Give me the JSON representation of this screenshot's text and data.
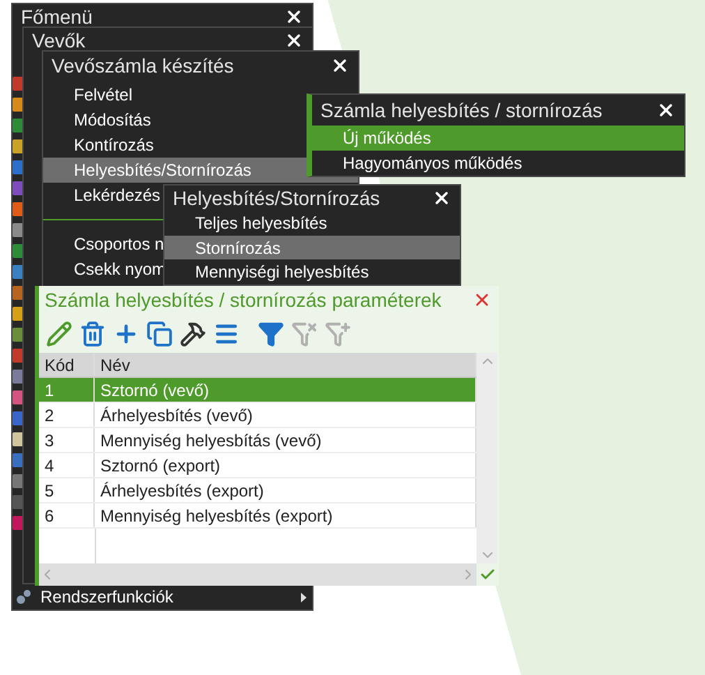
{
  "main_menu": {
    "title": "Főmenü",
    "footer_item": "Rendszerfunkciók"
  },
  "menus": [
    {
      "title": "Vevők"
    },
    {
      "title": "Vevőszámla készítés",
      "items": [
        {
          "label": "Felvétel",
          "selected": false
        },
        {
          "label": "Módosítás",
          "selected": false
        },
        {
          "label": "Kontírozás",
          "selected": false
        },
        {
          "label": "Helyesbítés/Stornírozás",
          "selected": true
        },
        {
          "label": "Lekérdezés",
          "selected": false
        },
        {
          "label": "Csoportos n",
          "selected": false,
          "separator_before": true
        },
        {
          "label": "Csekk nyom",
          "selected": false
        }
      ]
    },
    {
      "title": "Számla helyesbítés / stornírozás",
      "items": [
        {
          "label": "Új működés",
          "selected": true
        },
        {
          "label": "Hagyományos működés",
          "selected": false
        }
      ]
    },
    {
      "title": "Helyesbítés/Stornírozás",
      "items": [
        {
          "label": "Teljes helyesbítés",
          "selected": false
        },
        {
          "label": "Stornírozás",
          "selected": true
        },
        {
          "label": "Mennyiségi helyesbítés",
          "selected": false
        }
      ]
    }
  ],
  "dialog": {
    "title": "Számla helyesbítés / stornírozás paraméterek",
    "toolbar": [
      {
        "kind": "edit",
        "disabled": false
      },
      {
        "kind": "delete",
        "disabled": false
      },
      {
        "kind": "add",
        "disabled": false
      },
      {
        "kind": "copy",
        "disabled": false
      },
      {
        "kind": "tools",
        "disabled": false
      },
      {
        "kind": "list",
        "disabled": false
      },
      {
        "kind": "filter",
        "disabled": false
      },
      {
        "kind": "filter-clear",
        "disabled": true
      },
      {
        "kind": "filter-add",
        "disabled": true
      }
    ],
    "columns": [
      "Kód",
      "Név"
    ],
    "rows": [
      {
        "code": "1",
        "name": "Sztornó (vevő)",
        "selected": true
      },
      {
        "code": "2",
        "name": "Árhelyesbítés (vevő)",
        "selected": false
      },
      {
        "code": "3",
        "name": "Mennyiség helyesbítás (vevő)",
        "selected": false
      },
      {
        "code": "4",
        "name": "Sztornó (export)",
        "selected": false
      },
      {
        "code": "5",
        "name": "Árhelyesbítés (export)",
        "selected": false
      },
      {
        "code": "6",
        "name": "Mennyiség helyesbítés (export)",
        "selected": false
      }
    ]
  }
}
